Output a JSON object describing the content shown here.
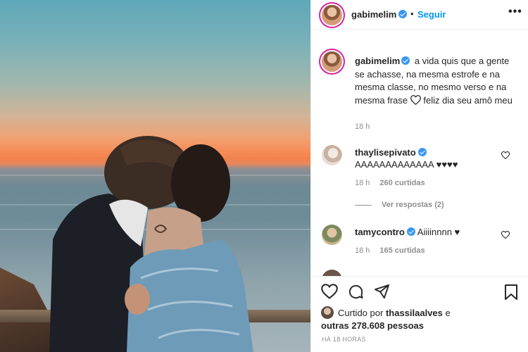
{
  "post": {
    "username": "gabimelim",
    "separator": "•",
    "follow_label": "Seguir",
    "more_label": "•••",
    "caption": "a vida quis que a gente se achasse, na mesma estrofe e na mesma classe, no mesmo verso e na mesma frase",
    "caption_after_heart": "feliz dia seu amô meu",
    "caption_time": "18 h"
  },
  "comments": [
    {
      "username": "thaylisepivato",
      "text": "AAAAAAAAAAAAA ♥♥♥♥",
      "time": "18 h",
      "likes": "260 curtidas",
      "replies": "Ver respostas (2)"
    },
    {
      "username": "tamycontro",
      "text": "Aiiiinnnn ♥",
      "time": "18 h",
      "likes": "165 curtidas"
    }
  ],
  "likes": {
    "prefix": "Curtido por",
    "user": "thassilaalves",
    "connector": "e",
    "others": "outras 278.608 pessoas"
  },
  "posted_ago": "HÁ 18 HORAS",
  "icons": {
    "like": "heart-icon",
    "comment": "comment-icon",
    "share": "paper-plane-icon",
    "save": "bookmark-icon",
    "verified": "verified-badge-icon"
  },
  "colors": {
    "link_blue": "#0095f6",
    "verified_blue": "#3897f0",
    "muted_text": "#8e8e8e",
    "sunset_orange": "#f58d57"
  }
}
